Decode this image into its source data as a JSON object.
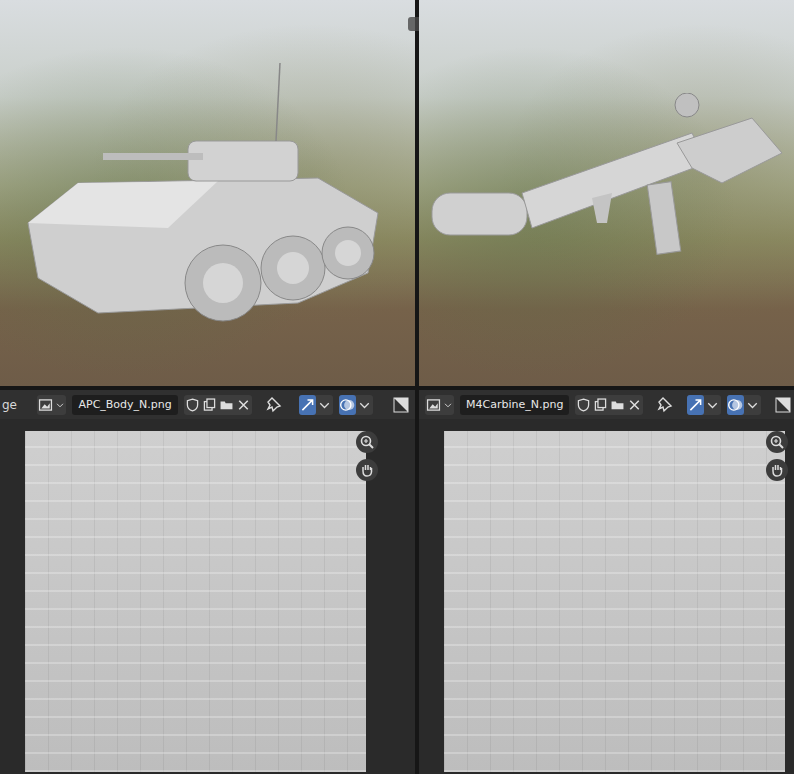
{
  "image_editors": [
    {
      "clipped_label": "ge",
      "image_name": "APC_Body_N.png"
    },
    {
      "clipped_label": "",
      "image_name": "M4Carbine_N.png"
    }
  ]
}
